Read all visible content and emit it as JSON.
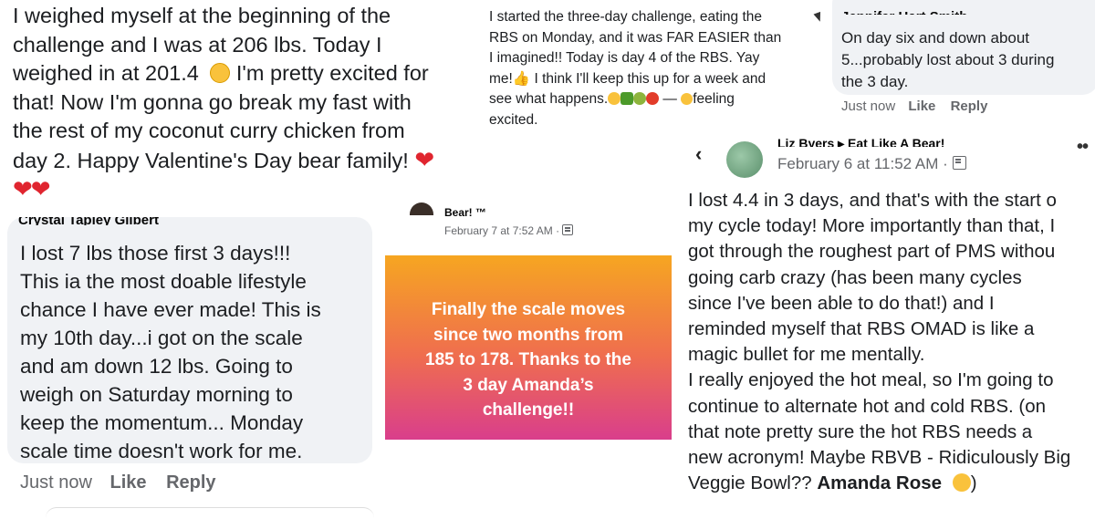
{
  "post_top_left": {
    "lines": [
      "I weighed myself at the beginning of the",
      "challenge and I was at 206 lbs. Today I",
      "weighed in at 201.4",
      " I'm pretty excited for",
      "that! Now I'm gonna go break my fast with",
      "the rest of my coconut curry chicken from",
      "day 2. Happy Valentine's Day bear family!"
    ],
    "hearts": "❤❤"
  },
  "post_top_mid": {
    "lines": [
      "I started the three-day challenge, eating the",
      "RBS  on Monday, and it was FAR EASIER than",
      "I imagined!!  Today is day 4 of the RBS. Yay",
      "me!",
      " I think I'll keep this up for a week and",
      "see what happens.",
      " — ",
      "feeling",
      "excited."
    ]
  },
  "comment_top_right": {
    "name_cut": "Jennifer Hart Smith",
    "lines": [
      "On day six and down about",
      "5...probably lost about 3 during",
      "the 3 day."
    ],
    "actions": {
      "time": "Just now",
      "like": "Like",
      "reply": "Reply"
    }
  },
  "comment_left": {
    "name_cut": "Crystal Tapley Gilbert",
    "lines": [
      "I lost 7 lbs those first 3 days!!!",
      "This ia the most doable lifestyle",
      "chance I have ever made! This is",
      "my 10th day...i got on the scale",
      "and am down 12 lbs. Going to",
      "weigh on Saturday morning to",
      "keep the momentum... Monday",
      "scale time doesn't work for me."
    ],
    "actions": {
      "time": "Just now",
      "like": "Like",
      "reply": "Reply"
    }
  },
  "post_center": {
    "author_cut": "Bear! ™",
    "timestamp": "February 7 at 7:52 AM ·",
    "card_lines": [
      "Finally the scale moves",
      "since two months from",
      "185 to 178. Thanks to the",
      "3 day Amanda’s",
      "challenge!!"
    ]
  },
  "post_right": {
    "author_cut": "Liz Byers ▸ Eat Like A Bear!",
    "timestamp": "February 6 at 11:52 AM ·",
    "lines": [
      "I lost 4.4 in 3 days, and that's with the start o",
      "my cycle today! More importantly than that, I",
      "got through the roughest part of PMS withou",
      "going carb crazy (has been many cycles",
      "since I've been able to do that!) and I",
      "reminded myself that RBS OMAD is like a",
      "magic bullet for me mentally.",
      "I really enjoyed the hot meal, so I'm going to",
      "continue to alternate hot and cold RBS. (on",
      "that note pretty sure the hot RBS needs a",
      "new acronym! Maybe RBVB - Ridiculously Big",
      "Veggie Bowl?? "
    ],
    "mention": "Amanda Rose",
    "closing": ")"
  },
  "colors": {
    "bubble": "#f0f2f5",
    "meta": "#65676b",
    "heart": "#e0252f",
    "card_gradient_top": "#f7a324",
    "card_gradient_bottom": "#d63a8f"
  }
}
